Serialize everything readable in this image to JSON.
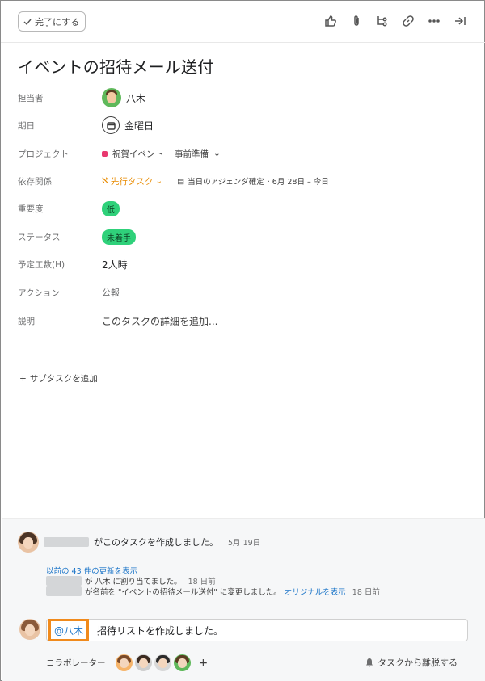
{
  "toolbar": {
    "complete_label": "完了にする",
    "icons": [
      "thumbs-up-icon",
      "attachment-icon",
      "subtask-icon",
      "link-icon",
      "more-icon",
      "close-panel-icon"
    ]
  },
  "task": {
    "title": "イベントの招待メール送付"
  },
  "fields": {
    "assignee": {
      "label": "担当者",
      "value": "八木"
    },
    "due": {
      "label": "期日",
      "value": "金曜日"
    },
    "project": {
      "label": "プロジェクト",
      "name": "祝賀イベント",
      "section": "事前準備",
      "color": "#e8386f"
    },
    "dependency": {
      "label": "依存関係",
      "value": "先行タスク",
      "related_task": "当日のアジェンダ確定",
      "related_dates": "· 6月 28日 – 今日"
    },
    "priority": {
      "label": "重要度",
      "value": "低"
    },
    "status": {
      "label": "ステータス",
      "value": "未着手"
    },
    "estimate": {
      "label": "予定工数(H)",
      "value": "2人時"
    },
    "action": {
      "label": "アクション",
      "value": "公報"
    },
    "description": {
      "label": "説明",
      "placeholder": "このタスクの詳細を追加..."
    }
  },
  "subtask": {
    "add_label": "サブタスクを追加"
  },
  "activity": {
    "created_text": "がこのタスクを作成しました。",
    "created_time": "5月 19日",
    "history_link": "以前の 43 件の更新を表示",
    "assigned_text": "が 八木 に割り当てました。",
    "assigned_time": "18 日前",
    "renamed_text": "が名前を \"イベントの招待メール送付\" に変更しました。",
    "renamed_link": "オリジナルを表示",
    "renamed_time": "18 日前"
  },
  "comment": {
    "mention": "@八木",
    "text": "招待リストを作成しました。"
  },
  "collaborators": {
    "label": "コラボレーター",
    "add": "+",
    "leave_label": "タスクから離脱する"
  },
  "colors": {
    "dependency": "#e88b00",
    "pill_green": "#2fd17a",
    "link": "#1a74c8",
    "highlight": "#f08a1c"
  }
}
